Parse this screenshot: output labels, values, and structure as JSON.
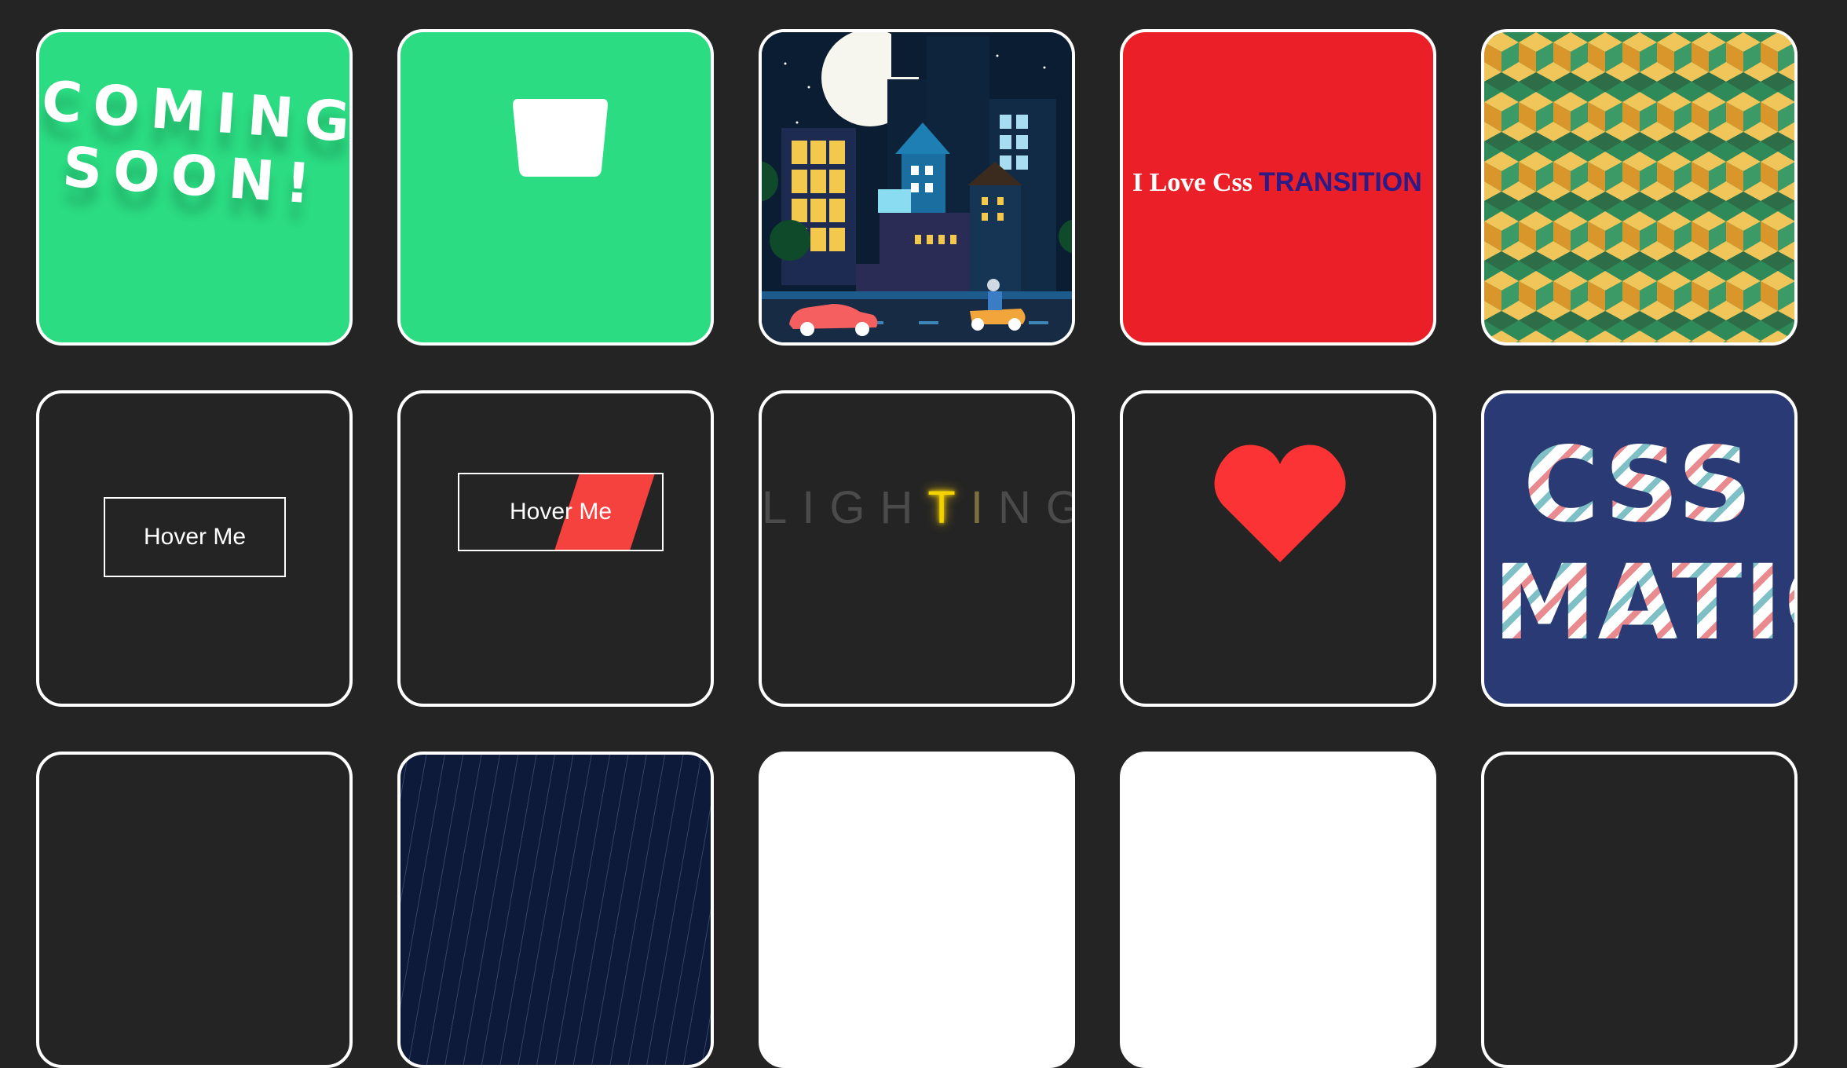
{
  "cards": {
    "coming_soon": {
      "line1": "COMING",
      "line2": "SOON!"
    },
    "love_transition": {
      "part1": "I Love Css",
      "part2": "TRANSITION"
    },
    "hover_box": {
      "label": "Hover Me"
    },
    "hover_slash": {
      "label": "Hover Me"
    },
    "lighting": {
      "letters": [
        "L",
        "I",
        "G",
        "H",
        "T",
        "I",
        "N",
        "G"
      ]
    },
    "css_animation": {
      "line1": "CSS",
      "line2": "IMATIO"
    }
  },
  "colors": {
    "background": "#242424",
    "green": "#2bdc82",
    "red": "#ea1f27",
    "navy": "#2a3a74",
    "heart": "#fc3335",
    "slash": "#f5423f",
    "lighting_on": "#f5d300"
  },
  "icons": [
    "cup-icon",
    "heart-icon"
  ]
}
